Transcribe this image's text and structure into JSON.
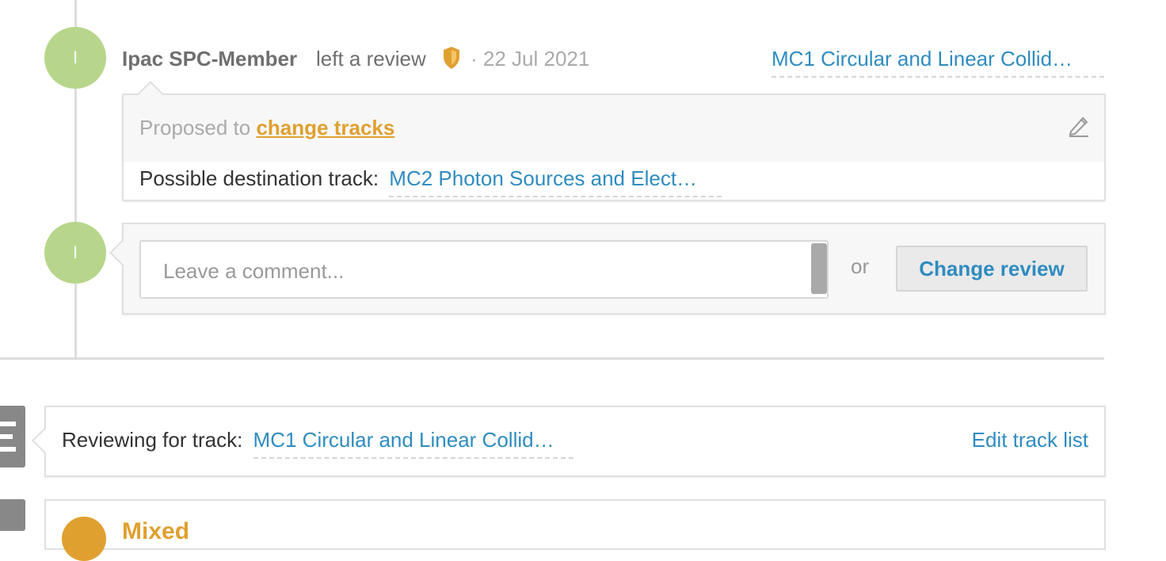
{
  "review": {
    "avatar_initial": "I",
    "author": "Ipac SPC-Member",
    "verb": "left a review",
    "separator": "·",
    "date": "22 Jul 2021",
    "track": "MC1 Circular and Linear Collid…",
    "proposal_prefix": "Proposed to",
    "proposal_action": "change tracks",
    "destination_label": "Possible destination track:",
    "destination_track": "MC2 Photon Sources and Elect…"
  },
  "comment": {
    "avatar_initial": "I",
    "placeholder": "Leave a comment...",
    "or": "or",
    "change_review_label": "Change review"
  },
  "track_panel": {
    "label": "Reviewing for track:",
    "track": "MC1 Circular and Linear Collid…",
    "edit_label": "Edit track list"
  },
  "next_item": {
    "title": "Mixed"
  },
  "colors": {
    "accent_blue": "#2f8cc0",
    "avatar_green": "#b7d68b",
    "accent_orange": "#e0a030"
  }
}
